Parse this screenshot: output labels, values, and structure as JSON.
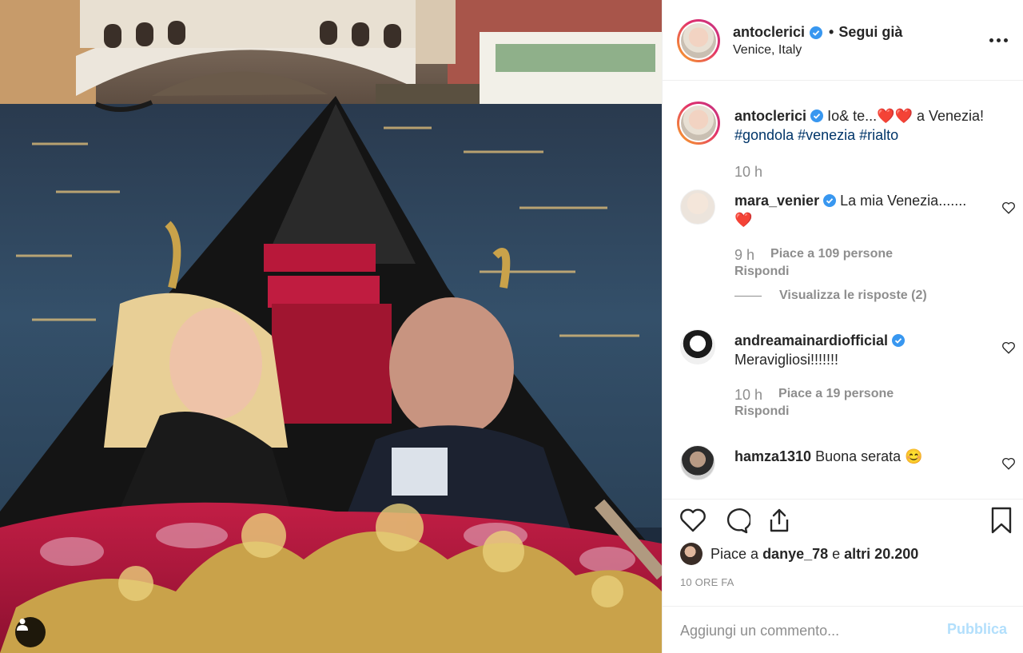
{
  "post": {
    "author": "antoclerici",
    "follow_status": "Segui già",
    "location": "Venice, Italy",
    "caption_username": "antoclerici",
    "caption_text": "Io& te...",
    "caption_hearts": "❤️❤️",
    "caption_suffix": "a Venezia!",
    "hashtags": [
      "#gondola",
      "#venezia",
      "#rialto"
    ],
    "caption_time": "10 h"
  },
  "comments": [
    {
      "username": "mara_venier",
      "text": "La mia Venezia.......",
      "emoji": "❤️",
      "time": "9 h",
      "likes": "Piace a 109 persone",
      "reply": "Rispondi",
      "view_replies": "Visualizza le risposte (2)"
    },
    {
      "username": "andreamainardiofficial",
      "text": "Meravigliosi!!!!!!!",
      "time": "10 h",
      "likes": "Piace a 19 persone",
      "reply": "Rispondi"
    },
    {
      "username": "hamza1310",
      "text": "Buona serata",
      "emoji": "😊"
    }
  ],
  "likes": {
    "prefix": "Piace a",
    "user": "danye_78",
    "conj": "e",
    "others": "altri 20.200"
  },
  "post_time": "10 ORE FA",
  "add_comment": {
    "placeholder": "Aggiungi un commento...",
    "publish_label": "Pubblica"
  },
  "colors": {
    "verified": "#3897f0",
    "hashtag": "#003569",
    "muted": "#8e8e8e",
    "publish_disabled": "#b2dffc"
  },
  "icons": [
    "verified-badge-icon",
    "more-options-icon",
    "heart-icon",
    "comment-icon",
    "share-icon",
    "bookmark-icon",
    "user-tag-icon"
  ]
}
